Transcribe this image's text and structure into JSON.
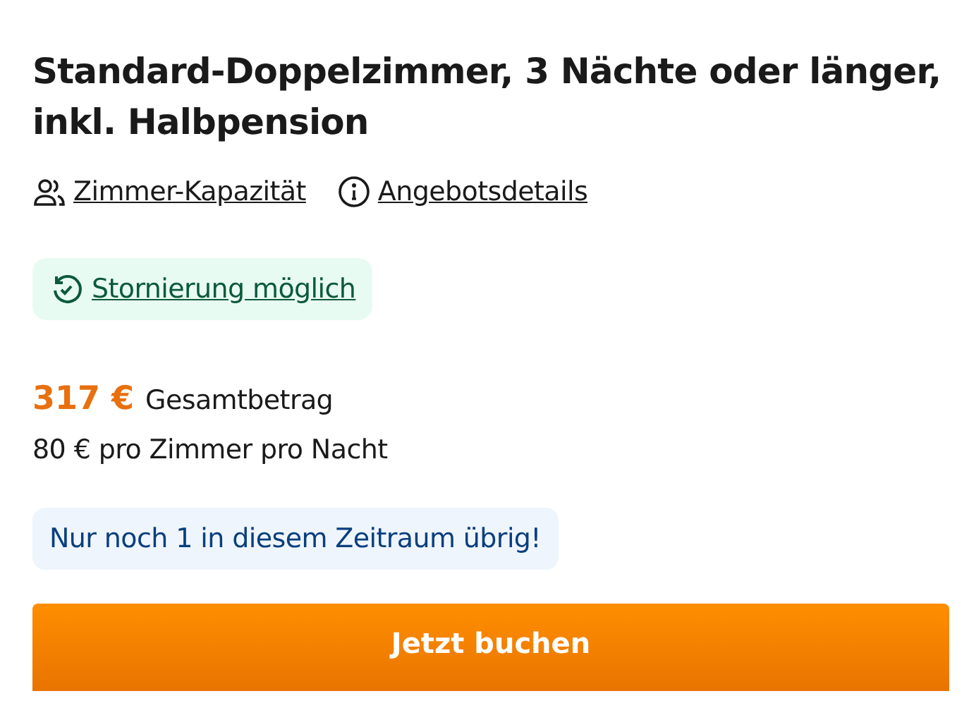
{
  "title": "Standard-Doppelzimmer, 3 Nächte oder länger, inkl. Halbpension",
  "links": [
    {
      "kind": "people",
      "label": "Zimmer-Kapazität"
    },
    {
      "kind": "info",
      "label": "Angebotsdetails"
    }
  ],
  "cancellation": {
    "label": "Stornierung möglich"
  },
  "price": {
    "total": "317 €",
    "total_label": "Gesamtbetrag",
    "per_night": "80 € pro Zimmer pro Nacht"
  },
  "availability_notice": "Nur noch 1 in diesem Zeitraum übrig!",
  "book_button": "Jetzt buchen"
}
